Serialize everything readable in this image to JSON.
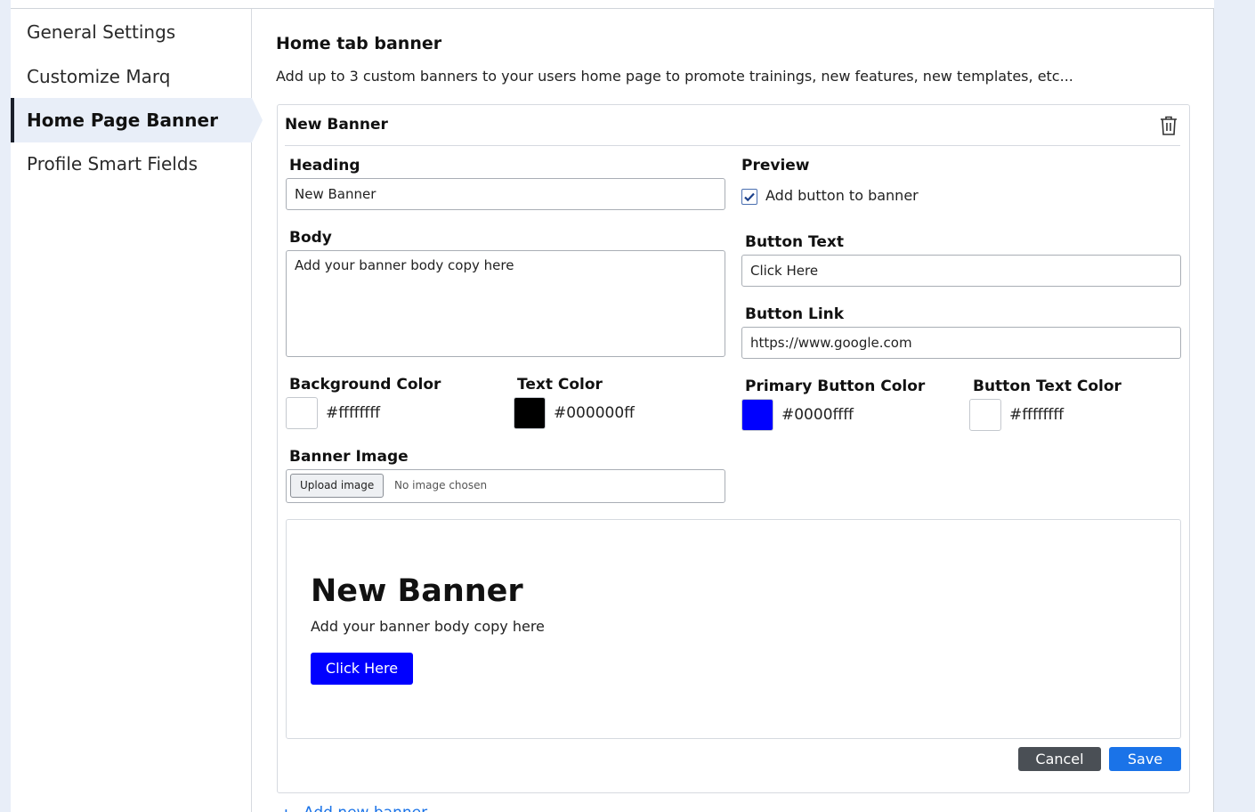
{
  "sidebar": {
    "items": [
      {
        "label": "General Settings"
      },
      {
        "label": "Customize Marq"
      },
      {
        "label": "Home Page Banner"
      },
      {
        "label": "Profile Smart Fields"
      }
    ],
    "active_index": 2
  },
  "main": {
    "title": "Home tab banner",
    "description": "Add up to 3 custom banners to your users home page to promote trainings, new features, new templates, etc...",
    "add_link_label": "Add new banner",
    "add_icon": "plus-icon"
  },
  "banner_card": {
    "title": "New Banner",
    "delete_icon": "trash-icon",
    "heading": {
      "label": "Heading",
      "value": "New Banner"
    },
    "body": {
      "label": "Body",
      "value": "Add your banner body copy here"
    },
    "preview": {
      "label": "Preview",
      "checkbox_label": "Add button to banner",
      "checked": true
    },
    "button_text": {
      "label": "Button Text",
      "value": "Click Here"
    },
    "button_link": {
      "label": "Button Link",
      "value": "https://www.google.com"
    },
    "background_color": {
      "label": "Background Color",
      "value": "#ffffffff",
      "swatch": "#ffffff"
    },
    "text_color": {
      "label": "Text Color",
      "value": "#000000ff",
      "swatch": "#000000"
    },
    "primary_button_color": {
      "label": "Primary Button Color",
      "value": "#0000ffff",
      "swatch": "#0000ff"
    },
    "button_text_color": {
      "label": "Button Text Color",
      "value": "#ffffffff",
      "swatch": "#ffffff"
    },
    "banner_image": {
      "label": "Banner Image",
      "upload_label": "Upload image",
      "status": "No image chosen"
    },
    "preview_render": {
      "heading": "New Banner",
      "body": "Add your banner body copy here",
      "button": "Click Here"
    },
    "actions": {
      "cancel_label": "Cancel",
      "save_label": "Save"
    }
  },
  "colors": {
    "accent": "#1a73e8",
    "sidebar_active_bg": "#e8eef8",
    "cancel_bg": "#4a4f55"
  }
}
